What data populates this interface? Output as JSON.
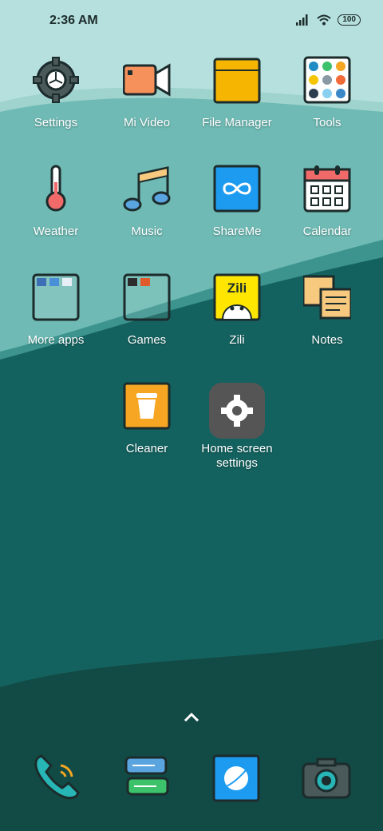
{
  "status_bar": {
    "time": "2:36 AM",
    "battery": "100"
  },
  "apps": [
    {
      "label": "Settings",
      "icon": "gear-icon"
    },
    {
      "label": "Mi Video",
      "icon": "video-camera-icon"
    },
    {
      "label": "File Manager",
      "icon": "folder-icon"
    },
    {
      "label": "Tools",
      "icon": "tools-grid-icon"
    },
    {
      "label": "Weather",
      "icon": "thermometer-icon"
    },
    {
      "label": "Music",
      "icon": "music-note-icon"
    },
    {
      "label": "ShareMe",
      "icon": "infinity-icon"
    },
    {
      "label": "Calendar",
      "icon": "calendar-icon"
    },
    {
      "label": "More apps",
      "icon": "folder-icon"
    },
    {
      "label": "Games",
      "icon": "folder-icon"
    },
    {
      "label": "Zili",
      "icon": "zili-icon",
      "icon_text": "Zili"
    },
    {
      "label": "Notes",
      "icon": "notes-icon"
    },
    {
      "label": "Cleaner",
      "icon": "trash-icon"
    },
    {
      "label": "Home screen settings",
      "label_line1": "Home screen",
      "label_line2": "settings",
      "icon": "gear-icon"
    }
  ],
  "dock": [
    {
      "icon": "phone-icon"
    },
    {
      "icon": "message-icon"
    },
    {
      "icon": "browser-icon"
    },
    {
      "icon": "camera-icon"
    }
  ],
  "colors": {
    "sky": "#b5e0dd",
    "hill1": "#6fbab4",
    "hill2": "#14625f",
    "ground": "#124b45"
  }
}
